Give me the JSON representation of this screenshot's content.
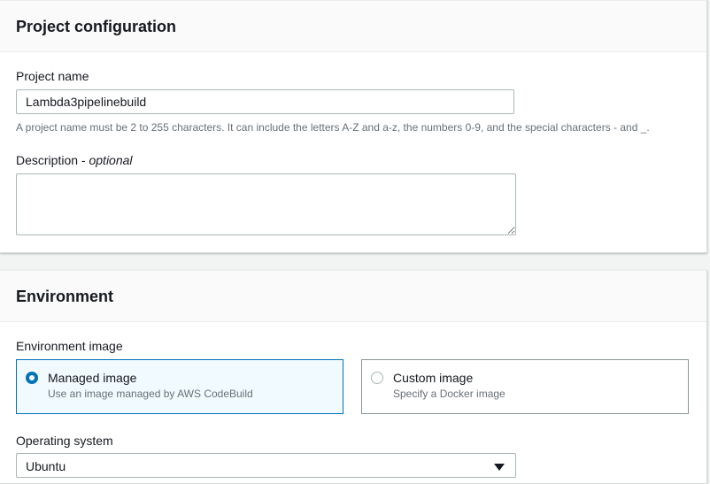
{
  "project_config": {
    "title": "Project configuration",
    "name_label": "Project name",
    "name_value": "Lambda3pipelinebuild",
    "name_hint": "A project name must be 2 to 255 characters. It can include the letters A-Z and a-z, the numbers 0-9, and the special characters - and _.",
    "description_label": "Description",
    "description_optional": "optional",
    "description_value": ""
  },
  "environment": {
    "title": "Environment",
    "image_label": "Environment image",
    "options": [
      {
        "title": "Managed image",
        "desc": "Use an image managed by AWS CodeBuild",
        "selected": true
      },
      {
        "title": "Custom image",
        "desc": "Specify a Docker image",
        "selected": false
      }
    ],
    "os_label": "Operating system",
    "os_value": "Ubuntu"
  },
  "colors": {
    "accent": "#0073bb",
    "selected_bg": "#f1faff",
    "page_bg": "#f2f3f3",
    "hint_text": "#687078"
  }
}
